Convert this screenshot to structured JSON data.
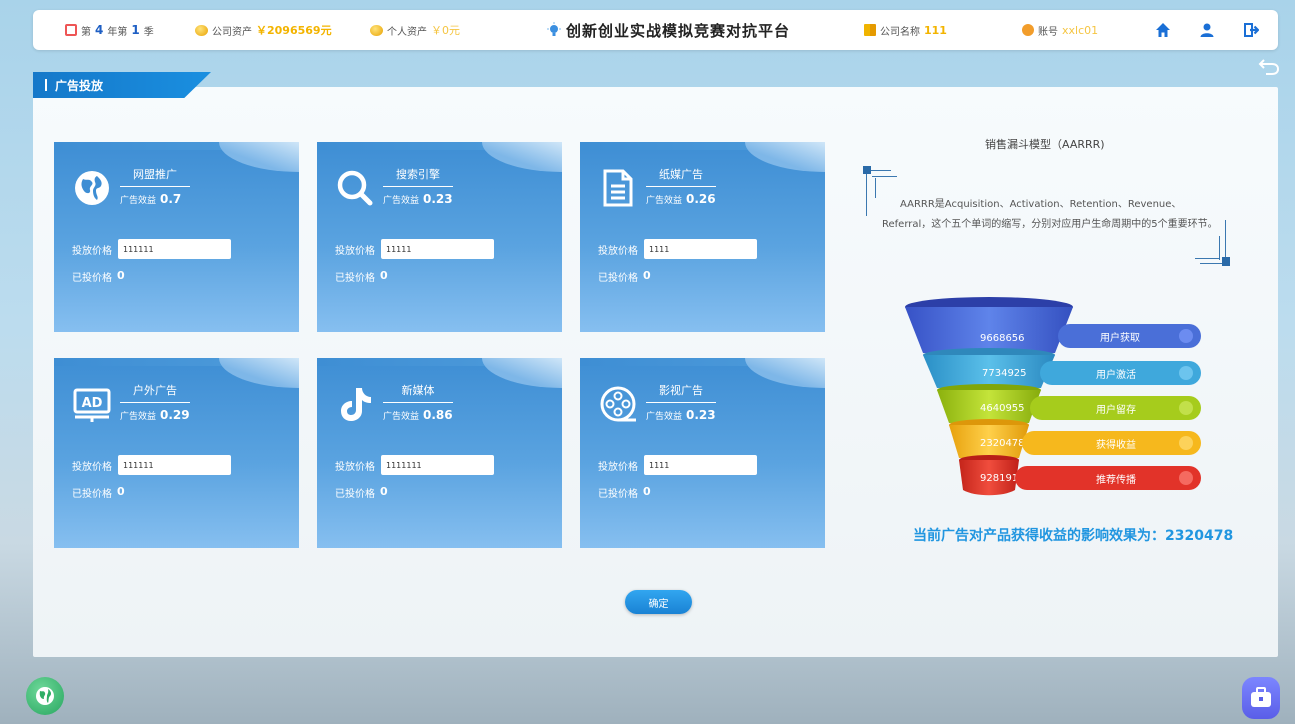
{
  "topbar": {
    "year_prefix": "第",
    "year": "4",
    "year_unit": "年第",
    "season": "1",
    "season_unit": "季",
    "company_assets_label": "公司资产",
    "company_assets_value": "￥2096569元",
    "personal_assets_label": "个人资产",
    "personal_assets_value": "￥0元",
    "title": "创新创业实战模拟竞赛对抗平台",
    "company_name_label": "公司名称",
    "company_name_value": "111",
    "account_label": "账号",
    "account_value": "xxlc01",
    "icons": [
      "home-icon",
      "user-icon",
      "logout-icon"
    ]
  },
  "panel": {
    "tab_title": "广告投放",
    "price_label": "投放价格",
    "placed_label": "已投价格",
    "effect_label": "广告效益",
    "cards": [
      {
        "name": "网盟推广",
        "icon": "globe-icon",
        "effect": "0.7",
        "price": "111111",
        "placed": "0"
      },
      {
        "name": "搜索引擎",
        "icon": "search-icon",
        "effect": "0.23",
        "price": "11111",
        "placed": "0"
      },
      {
        "name": "纸媒广告",
        "icon": "document-icon",
        "effect": "0.26",
        "price": "1111",
        "placed": "0"
      },
      {
        "name": "户外广告",
        "icon": "ad-board-icon",
        "effect": "0.29",
        "price": "111111",
        "placed": "0"
      },
      {
        "name": "新媒体",
        "icon": "tiktok-icon",
        "effect": "0.86",
        "price": "1111111",
        "placed": "0"
      },
      {
        "name": "影视广告",
        "icon": "film-reel-icon",
        "effect": "0.23",
        "price": "1111",
        "placed": "0"
      }
    ],
    "confirm_label": "确定"
  },
  "funnel": {
    "title": "销售漏斗模型（AARRR)",
    "description": "AARRR是Acquisition、Activation、Retention、Revenue、Referral，这个五个单词的缩写，分别对应用户生命周期中的5个重要环节。",
    "stages": [
      {
        "value": "9668656",
        "label": "用户获取",
        "color": "#4a6fd8"
      },
      {
        "value": "7734925",
        "label": "用户激活",
        "color": "#3fa8dc"
      },
      {
        "value": "4640955",
        "label": "用户留存",
        "color": "#a6cc1c"
      },
      {
        "value": "2320478",
        "label": "获得收益",
        "color": "#f6b81d"
      },
      {
        "value": "928191",
        "label": "推荐传播",
        "color": "#e23329"
      }
    ],
    "effect_text": "当前广告对产品获得收益的影响效果为：2320478"
  }
}
